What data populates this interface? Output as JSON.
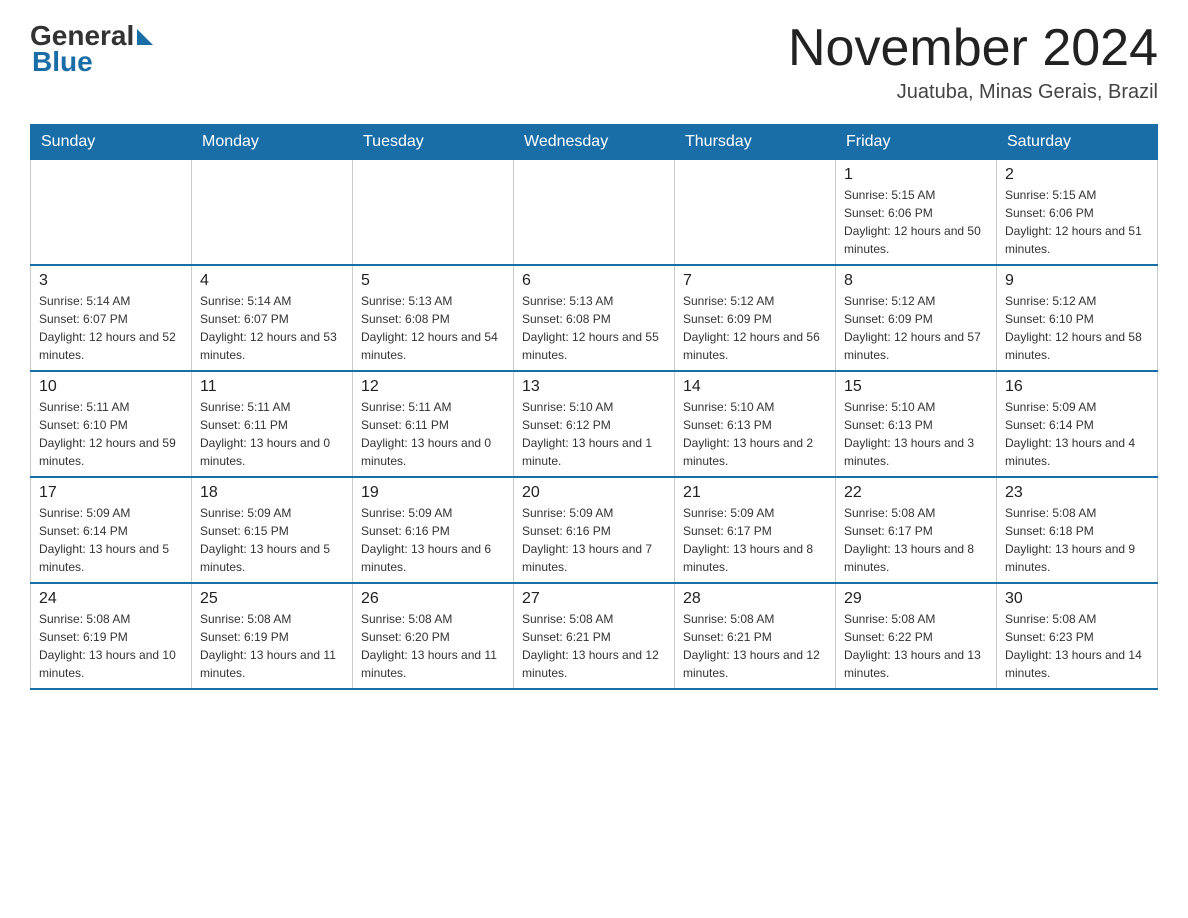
{
  "header": {
    "logo_general": "General",
    "logo_blue": "Blue",
    "month_title": "November 2024",
    "location": "Juatuba, Minas Gerais, Brazil"
  },
  "weekdays": [
    "Sunday",
    "Monday",
    "Tuesday",
    "Wednesday",
    "Thursday",
    "Friday",
    "Saturday"
  ],
  "weeks": [
    [
      {
        "day": "",
        "sunrise": "",
        "sunset": "",
        "daylight": ""
      },
      {
        "day": "",
        "sunrise": "",
        "sunset": "",
        "daylight": ""
      },
      {
        "day": "",
        "sunrise": "",
        "sunset": "",
        "daylight": ""
      },
      {
        "day": "",
        "sunrise": "",
        "sunset": "",
        "daylight": ""
      },
      {
        "day": "",
        "sunrise": "",
        "sunset": "",
        "daylight": ""
      },
      {
        "day": "1",
        "sunrise": "Sunrise: 5:15 AM",
        "sunset": "Sunset: 6:06 PM",
        "daylight": "Daylight: 12 hours and 50 minutes."
      },
      {
        "day": "2",
        "sunrise": "Sunrise: 5:15 AM",
        "sunset": "Sunset: 6:06 PM",
        "daylight": "Daylight: 12 hours and 51 minutes."
      }
    ],
    [
      {
        "day": "3",
        "sunrise": "Sunrise: 5:14 AM",
        "sunset": "Sunset: 6:07 PM",
        "daylight": "Daylight: 12 hours and 52 minutes."
      },
      {
        "day": "4",
        "sunrise": "Sunrise: 5:14 AM",
        "sunset": "Sunset: 6:07 PM",
        "daylight": "Daylight: 12 hours and 53 minutes."
      },
      {
        "day": "5",
        "sunrise": "Sunrise: 5:13 AM",
        "sunset": "Sunset: 6:08 PM",
        "daylight": "Daylight: 12 hours and 54 minutes."
      },
      {
        "day": "6",
        "sunrise": "Sunrise: 5:13 AM",
        "sunset": "Sunset: 6:08 PM",
        "daylight": "Daylight: 12 hours and 55 minutes."
      },
      {
        "day": "7",
        "sunrise": "Sunrise: 5:12 AM",
        "sunset": "Sunset: 6:09 PM",
        "daylight": "Daylight: 12 hours and 56 minutes."
      },
      {
        "day": "8",
        "sunrise": "Sunrise: 5:12 AM",
        "sunset": "Sunset: 6:09 PM",
        "daylight": "Daylight: 12 hours and 57 minutes."
      },
      {
        "day": "9",
        "sunrise": "Sunrise: 5:12 AM",
        "sunset": "Sunset: 6:10 PM",
        "daylight": "Daylight: 12 hours and 58 minutes."
      }
    ],
    [
      {
        "day": "10",
        "sunrise": "Sunrise: 5:11 AM",
        "sunset": "Sunset: 6:10 PM",
        "daylight": "Daylight: 12 hours and 59 minutes."
      },
      {
        "day": "11",
        "sunrise": "Sunrise: 5:11 AM",
        "sunset": "Sunset: 6:11 PM",
        "daylight": "Daylight: 13 hours and 0 minutes."
      },
      {
        "day": "12",
        "sunrise": "Sunrise: 5:11 AM",
        "sunset": "Sunset: 6:11 PM",
        "daylight": "Daylight: 13 hours and 0 minutes."
      },
      {
        "day": "13",
        "sunrise": "Sunrise: 5:10 AM",
        "sunset": "Sunset: 6:12 PM",
        "daylight": "Daylight: 13 hours and 1 minute."
      },
      {
        "day": "14",
        "sunrise": "Sunrise: 5:10 AM",
        "sunset": "Sunset: 6:13 PM",
        "daylight": "Daylight: 13 hours and 2 minutes."
      },
      {
        "day": "15",
        "sunrise": "Sunrise: 5:10 AM",
        "sunset": "Sunset: 6:13 PM",
        "daylight": "Daylight: 13 hours and 3 minutes."
      },
      {
        "day": "16",
        "sunrise": "Sunrise: 5:09 AM",
        "sunset": "Sunset: 6:14 PM",
        "daylight": "Daylight: 13 hours and 4 minutes."
      }
    ],
    [
      {
        "day": "17",
        "sunrise": "Sunrise: 5:09 AM",
        "sunset": "Sunset: 6:14 PM",
        "daylight": "Daylight: 13 hours and 5 minutes."
      },
      {
        "day": "18",
        "sunrise": "Sunrise: 5:09 AM",
        "sunset": "Sunset: 6:15 PM",
        "daylight": "Daylight: 13 hours and 5 minutes."
      },
      {
        "day": "19",
        "sunrise": "Sunrise: 5:09 AM",
        "sunset": "Sunset: 6:16 PM",
        "daylight": "Daylight: 13 hours and 6 minutes."
      },
      {
        "day": "20",
        "sunrise": "Sunrise: 5:09 AM",
        "sunset": "Sunset: 6:16 PM",
        "daylight": "Daylight: 13 hours and 7 minutes."
      },
      {
        "day": "21",
        "sunrise": "Sunrise: 5:09 AM",
        "sunset": "Sunset: 6:17 PM",
        "daylight": "Daylight: 13 hours and 8 minutes."
      },
      {
        "day": "22",
        "sunrise": "Sunrise: 5:08 AM",
        "sunset": "Sunset: 6:17 PM",
        "daylight": "Daylight: 13 hours and 8 minutes."
      },
      {
        "day": "23",
        "sunrise": "Sunrise: 5:08 AM",
        "sunset": "Sunset: 6:18 PM",
        "daylight": "Daylight: 13 hours and 9 minutes."
      }
    ],
    [
      {
        "day": "24",
        "sunrise": "Sunrise: 5:08 AM",
        "sunset": "Sunset: 6:19 PM",
        "daylight": "Daylight: 13 hours and 10 minutes."
      },
      {
        "day": "25",
        "sunrise": "Sunrise: 5:08 AM",
        "sunset": "Sunset: 6:19 PM",
        "daylight": "Daylight: 13 hours and 11 minutes."
      },
      {
        "day": "26",
        "sunrise": "Sunrise: 5:08 AM",
        "sunset": "Sunset: 6:20 PM",
        "daylight": "Daylight: 13 hours and 11 minutes."
      },
      {
        "day": "27",
        "sunrise": "Sunrise: 5:08 AM",
        "sunset": "Sunset: 6:21 PM",
        "daylight": "Daylight: 13 hours and 12 minutes."
      },
      {
        "day": "28",
        "sunrise": "Sunrise: 5:08 AM",
        "sunset": "Sunset: 6:21 PM",
        "daylight": "Daylight: 13 hours and 12 minutes."
      },
      {
        "day": "29",
        "sunrise": "Sunrise: 5:08 AM",
        "sunset": "Sunset: 6:22 PM",
        "daylight": "Daylight: 13 hours and 13 minutes."
      },
      {
        "day": "30",
        "sunrise": "Sunrise: 5:08 AM",
        "sunset": "Sunset: 6:23 PM",
        "daylight": "Daylight: 13 hours and 14 minutes."
      }
    ]
  ]
}
